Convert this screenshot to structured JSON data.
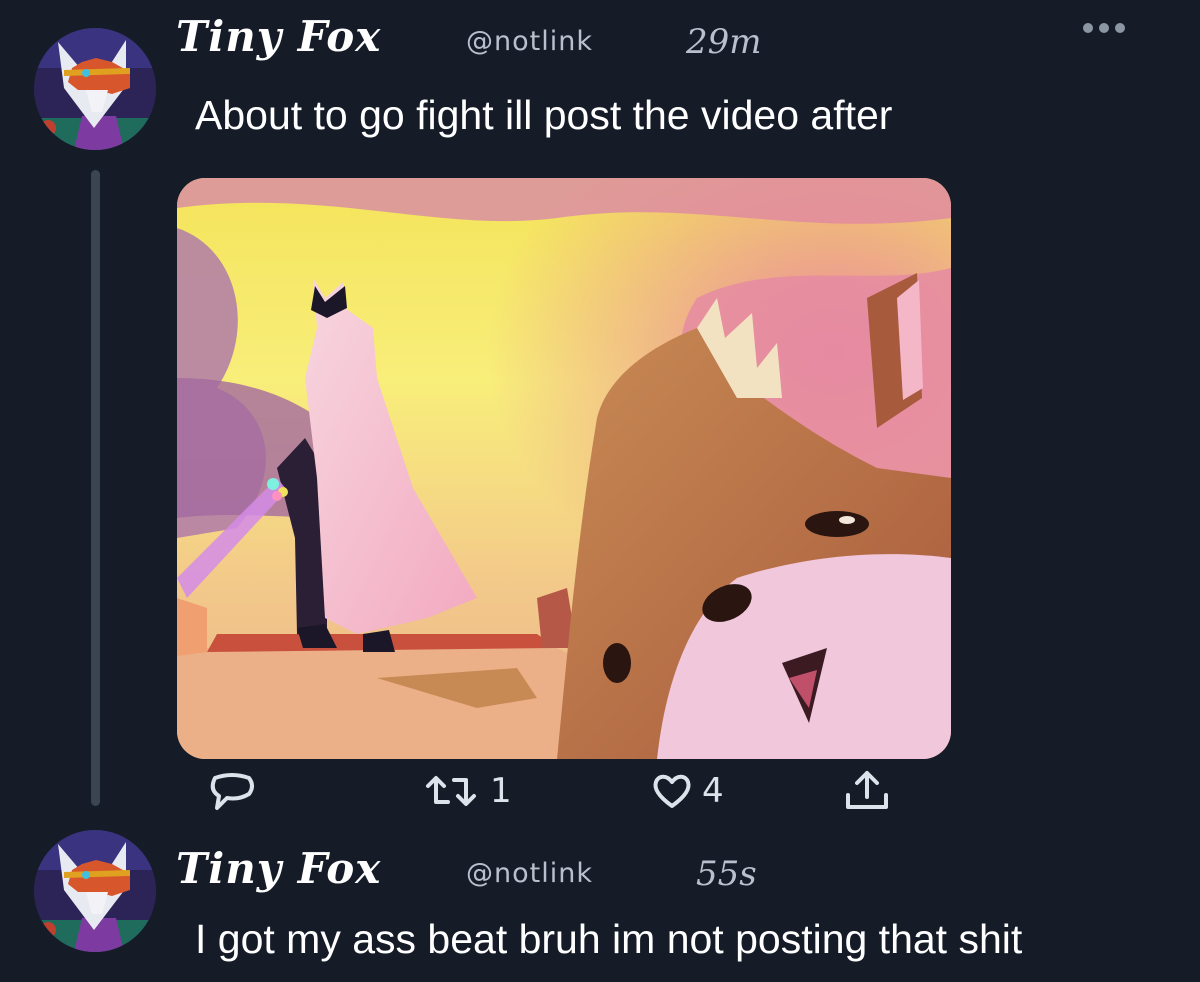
{
  "tweets": [
    {
      "display_name": "Tiny Fox",
      "handle": "@notlink",
      "timestamp": "29m",
      "text": "About to go fight ill post the video after",
      "has_media": true,
      "actions": {
        "reply_count": "",
        "retweet_count": "1",
        "like_count": "4"
      }
    },
    {
      "display_name": "Tiny Fox",
      "handle": "@notlink",
      "timestamp": "55s",
      "text": "I got my ass beat bruh im not posting that shit"
    }
  ],
  "icons": {
    "more": "more-options-icon",
    "reply": "reply-icon",
    "retweet": "retweet-icon",
    "like": "heart-icon",
    "share": "share-icon"
  },
  "colors": {
    "background": "#151c28",
    "thread_line": "#3b4552",
    "text_primary": "#ffffff",
    "text_secondary": "#b7c0cc",
    "icon": "#dde3ea"
  }
}
